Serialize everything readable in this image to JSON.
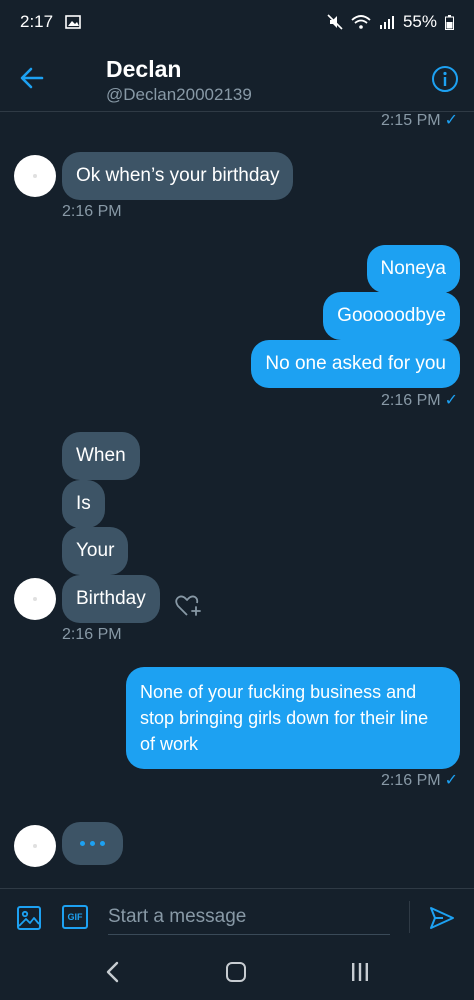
{
  "status_bar": {
    "time": "2:17",
    "battery": "55%"
  },
  "header": {
    "name": "Declan",
    "handle": "@Declan20002139"
  },
  "messages": {
    "ts_top": "2:15 PM",
    "recv1": "Ok when’s your birthday",
    "ts_recv1": "2:16 PM",
    "sent1": "Noneya",
    "sent2": "Gooooodbye",
    "sent3": "No one asked for you",
    "ts_sent_group1": "2:16 PM",
    "recv2": "When",
    "recv3": "Is",
    "recv4": "Your",
    "recv5": "Birthday",
    "ts_recv_group2": "2:16 PM",
    "sent4": "None of your fucking business and stop bringing girls down for their line of work",
    "ts_sent4": "2:16 PM",
    "check": "✓"
  },
  "composer": {
    "placeholder": "Start a message",
    "gif_label": "GIF"
  },
  "colors": {
    "background": "#15202b",
    "accent": "#1da1f2",
    "received_bubble": "#3d5466",
    "muted_text": "#8899a6"
  },
  "icons": [
    "image-icon",
    "gear-icon",
    "back-arrow-icon",
    "info-icon",
    "heart-add-icon",
    "send-icon"
  ]
}
